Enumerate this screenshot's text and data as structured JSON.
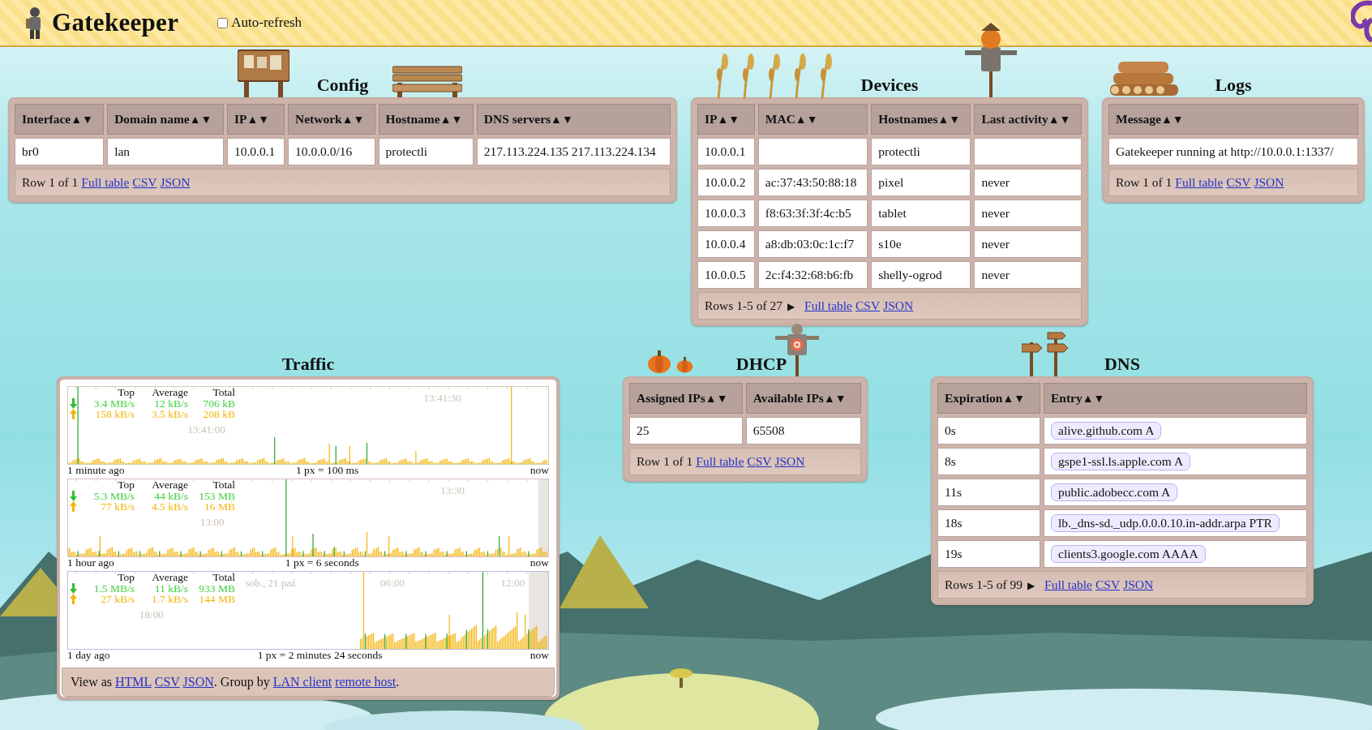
{
  "header": {
    "title": "Gatekeeper",
    "auto_refresh": {
      "label": "Auto-refresh",
      "checked": false
    }
  },
  "config": {
    "title": "Config",
    "columns": [
      {
        "label": "Interface",
        "sort": [
          "▲",
          "▼"
        ]
      },
      {
        "label": "Domain name",
        "sort": [
          "▲",
          "▼"
        ]
      },
      {
        "label": "IP",
        "sort": [
          "▲",
          "▼"
        ]
      },
      {
        "label": "Network",
        "sort": [
          "▲",
          "▼"
        ]
      },
      {
        "label": "Hostname",
        "sort": [
          "▲",
          "▼"
        ]
      },
      {
        "label": "DNS servers",
        "sort": [
          "▲",
          "▼"
        ]
      }
    ],
    "rows": [
      [
        "br0",
        "lan",
        "10.0.0.1",
        "10.0.0.0/16",
        "protectli",
        "217.113.224.135 217.113.224.134"
      ]
    ],
    "footer": {
      "summary": "Row 1 of 1",
      "links": [
        "Full table",
        "CSV",
        "JSON"
      ]
    }
  },
  "devices": {
    "title": "Devices",
    "columns": [
      {
        "label": "IP",
        "sort": [
          "▲",
          "▼"
        ]
      },
      {
        "label": "MAC",
        "sort": [
          "▲",
          "▼"
        ]
      },
      {
        "label": "Hostnames",
        "sort": [
          "▲",
          "▼"
        ]
      },
      {
        "label": "Last activity",
        "sort": [
          "▲",
          "▼"
        ]
      }
    ],
    "rows": [
      [
        "10.0.0.1",
        null,
        "protectli",
        null
      ],
      [
        "10.0.0.2",
        "ac:37:43:50:88:18",
        "pixel",
        "never"
      ],
      [
        "10.0.0.3",
        "f8:63:3f:3f:4c:b5",
        "tablet",
        "never"
      ],
      [
        "10.0.0.4",
        "a8:db:03:0c:1c:f7",
        "s10e",
        "never"
      ],
      [
        "10.0.0.5",
        "2c:f4:32:68:b6:fb",
        "shelly-ogrod",
        "never"
      ]
    ],
    "footer": {
      "summary": "Rows 1-5 of 27",
      "next": "▶",
      "links": [
        "Full table",
        "CSV",
        "JSON"
      ]
    }
  },
  "logs": {
    "title": "Logs",
    "columns": [
      {
        "label": "Message",
        "sort": [
          "▲",
          "▼"
        ]
      }
    ],
    "rows": [
      [
        "Gatekeeper running at http://10.0.0.1:1337/"
      ]
    ],
    "footer": {
      "summary": "Row 1 of 1",
      "links": [
        "Full table",
        "CSV",
        "JSON"
      ]
    }
  },
  "traffic": {
    "title": "Traffic",
    "graphs": [
      {
        "headers": [
          "Top",
          "Average",
          "Total"
        ],
        "download": [
          "3.4 MB/s",
          "12 kB/s",
          "706 kB"
        ],
        "upload": [
          "158 kB/s",
          "3.5 kB/s",
          "208 kB"
        ],
        "ticks": [
          "13:41:00",
          "13:41:30"
        ],
        "start": "1 minute ago",
        "scale": "1 px = 100 ms",
        "end": "now"
      },
      {
        "headers": [
          "Top",
          "Average",
          "Total"
        ],
        "download": [
          "5.3 MB/s",
          "44 kB/s",
          "153 MB"
        ],
        "upload": [
          "77 kB/s",
          "4.5 kB/s",
          "16 MB"
        ],
        "ticks": [
          "13:00",
          "13:30"
        ],
        "start": "1 hour ago",
        "scale": "1 px = 6 seconds",
        "end": "now"
      },
      {
        "headers": [
          "Top",
          "Average",
          "Total"
        ],
        "download": [
          "1.5 MB/s",
          "11 kB/s",
          "933 MB"
        ],
        "upload": [
          "27 kB/s",
          "1.7 kB/s",
          "144 MB"
        ],
        "ticks": [
          "18:00",
          "sob., 21 paź",
          "06:00",
          "12:00"
        ],
        "start": "1 day ago",
        "scale": "1 px = 2 minutes 24 seconds",
        "end": "now"
      }
    ],
    "footer": [
      {
        "kind": "text",
        "text": "View as"
      },
      {
        "kind": "link",
        "text": "HTML"
      },
      {
        "kind": "link",
        "text": "CSV"
      },
      {
        "kind": "link",
        "text": "JSON"
      },
      {
        "kind": "text",
        "text": ". Group by"
      },
      {
        "kind": "link",
        "text": "LAN client"
      },
      {
        "kind": "link",
        "text": "remote host"
      },
      {
        "kind": "text",
        "text": "."
      }
    ]
  },
  "dhcp": {
    "title": "DHCP",
    "columns": [
      {
        "label": "Assigned IPs",
        "sort": [
          "▲",
          "▼"
        ]
      },
      {
        "label": "Available IPs",
        "sort": [
          "▲",
          "▼"
        ]
      }
    ],
    "rows": [
      [
        "25",
        "65508"
      ]
    ],
    "footer": {
      "summary": "Row 1 of 1",
      "links": [
        "Full table",
        "CSV",
        "JSON"
      ]
    }
  },
  "dns": {
    "title": "DNS",
    "columns": [
      {
        "label": "Expiration",
        "sort": [
          "▲",
          "▼"
        ],
        "kind": "text"
      },
      {
        "label": "Entry",
        "sort": [
          "▲",
          "▼"
        ],
        "kind": "pill"
      }
    ],
    "rows": [
      [
        "0s",
        "alive.github.com A"
      ],
      [
        "8s",
        "gspe1-ssl.ls.apple.com A"
      ],
      [
        "11s",
        "public.adobecc.com A"
      ],
      [
        "18s",
        "lb._dns-sd._udp.0.0.0.10.in-addr.arpa PTR"
      ],
      [
        "19s",
        "clients3.google.com AAAA"
      ]
    ],
    "footer": {
      "summary": "Rows 1-5 of 99",
      "next": "▶",
      "links": [
        "Full table",
        "CSV",
        "JSON"
      ]
    }
  }
}
